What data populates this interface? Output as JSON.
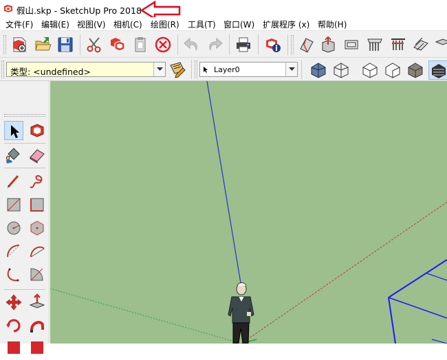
{
  "window": {
    "title": "假山.skp - SketchUp Pro 2018"
  },
  "menubar": {
    "items": [
      {
        "label": "文件(F)"
      },
      {
        "label": "编辑(E)"
      },
      {
        "label": "视图(V)"
      },
      {
        "label": "相机(C)"
      },
      {
        "label": "绘图(R)"
      },
      {
        "label": "工具(T)"
      },
      {
        "label": "窗口(W)"
      },
      {
        "label": "扩展程序 (x)"
      },
      {
        "label": "帮助(H)"
      }
    ]
  },
  "entity_info": {
    "type_value": "类型: <undefined>"
  },
  "layer": {
    "current_layer": "Layer0"
  },
  "colors": {
    "viewport_background": "#9cbf8d",
    "annotation_arrow": "#e8001c",
    "blue_axis": "#2035c8",
    "red_axis": "#c0392b",
    "green_axis": "#2ea043"
  },
  "icons": {
    "toolbar": [
      "new-icon",
      "open-icon",
      "save-icon",
      "cut-icon",
      "copy-icon",
      "paste-icon",
      "erase-icon",
      "undo-icon",
      "redo-icon",
      "print-icon",
      "model-info-icon",
      "make-face-icon",
      "push-pull-icon",
      "follow-me-icon",
      "section-icon",
      "intersect-icon",
      "flip-icon"
    ],
    "styles": [
      "xray-icon",
      "wireframe-icon",
      "hidden-line-icon",
      "shaded-icon",
      "shaded-textures-icon",
      "monochrome-icon"
    ],
    "left": [
      "select-icon",
      "make-component-icon",
      "paint-bucket-icon",
      "eraser-icon",
      "line-icon",
      "freehand-icon",
      "rectangle-icon",
      "rotated-rectangle-icon",
      "circle-icon",
      "polygon-icon",
      "arc-icon",
      "two-point-arc-icon",
      "three-point-arc-icon",
      "pie-icon",
      "move-icon",
      "push-pull-icon",
      "rotate-icon",
      "follow-me-icon"
    ]
  }
}
